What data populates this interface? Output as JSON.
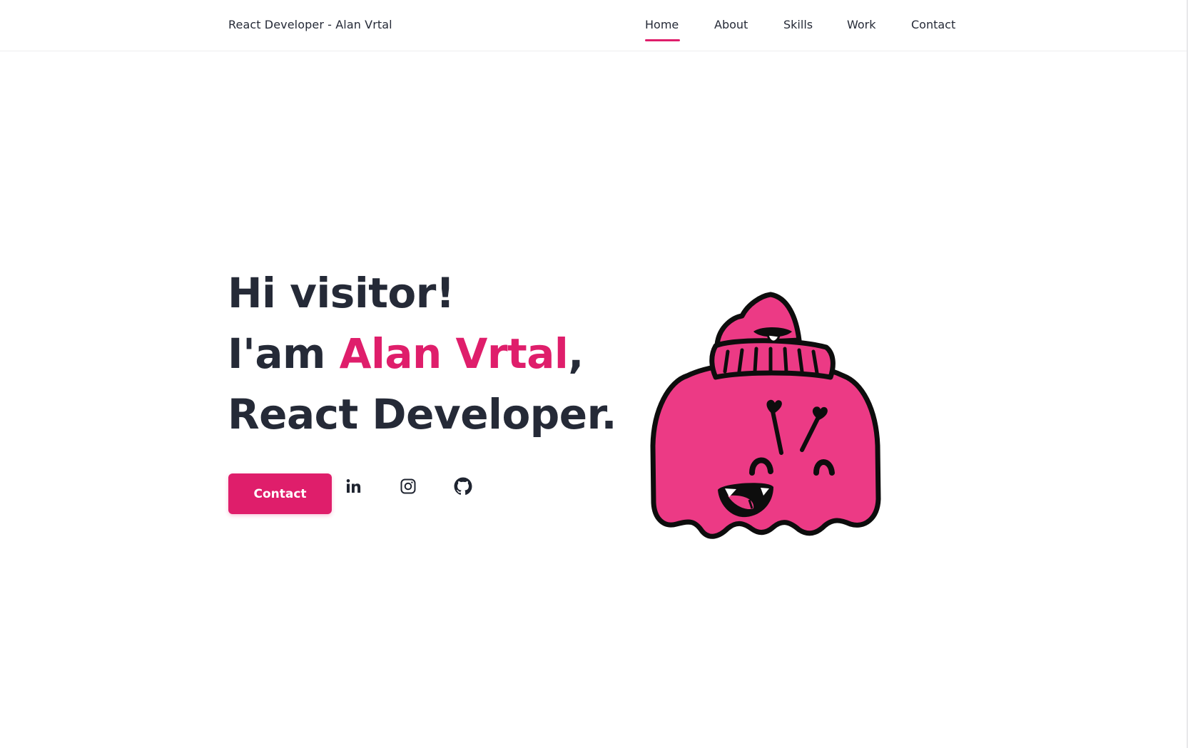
{
  "header": {
    "brand": "React Developer - Alan Vrtal",
    "nav": {
      "home": "Home",
      "about": "About",
      "skills": "Skills",
      "work": "Work",
      "contact": "Contact"
    },
    "active": "Home"
  },
  "hero": {
    "line1": "Hi visitor!",
    "line2_prefix": "I'am ",
    "name": "Alan Vrtal",
    "line2_suffix": ",",
    "line3": "React Developer.",
    "contact_button": "Contact"
  },
  "social": {
    "icons": [
      "linkedin-icon",
      "instagram-icon",
      "github-icon"
    ]
  },
  "colors": {
    "accent": "#df1e6b",
    "text": "#252a37",
    "mascot": "#ec3a85"
  }
}
